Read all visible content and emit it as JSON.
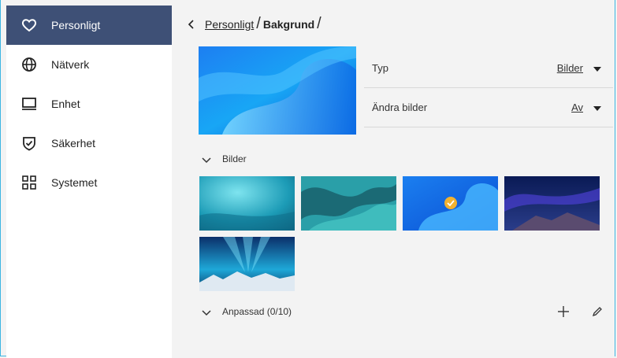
{
  "sidebar": {
    "items": [
      {
        "label": "Personligt",
        "icon": "heart-icon",
        "active": true
      },
      {
        "label": "Nätverk",
        "icon": "globe-icon"
      },
      {
        "label": "Enhet",
        "icon": "monitor-icon"
      },
      {
        "label": "Säkerhet",
        "icon": "shield-check-icon"
      },
      {
        "label": "Systemet",
        "icon": "grid-icon"
      }
    ]
  },
  "breadcrumb": {
    "parent": "Personligt",
    "current": "Bakgrund",
    "separator": "/"
  },
  "settings": {
    "type": {
      "label": "Typ",
      "value": "Bilder"
    },
    "change_images": {
      "label": "Ändra bilder",
      "value": "Av"
    }
  },
  "sections": {
    "images": "Bilder",
    "custom": "Anpassad (0/10)"
  },
  "gallery": {
    "selected_index": 2,
    "count": 5
  },
  "colors": {
    "accent": "#3e5076",
    "check": "#f2b230",
    "border": "#3cb6e3"
  }
}
